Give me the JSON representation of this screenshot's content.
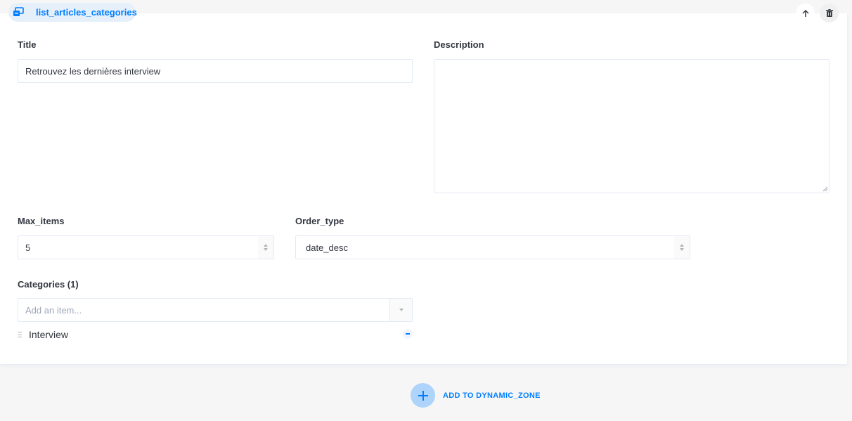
{
  "component": {
    "name": "list_articles_categories",
    "icon": "component-icon",
    "move_up_icon": "arrow-up-icon",
    "delete_icon": "trash-icon"
  },
  "fields": {
    "title": {
      "label": "Title",
      "value": "Retrouvez les dernières interview"
    },
    "description": {
      "label": "Description",
      "value": ""
    },
    "max_items": {
      "label": "Max_items",
      "value": "5"
    },
    "order_type": {
      "label": "Order_type",
      "value": "date_desc"
    },
    "categories": {
      "label": "Categories (1)",
      "placeholder": "Add an item...",
      "items": [
        {
          "label": "Interview"
        }
      ]
    }
  },
  "dynamic_zone": {
    "add_label": "ADD TO DYNAMIC_ZONE"
  },
  "colors": {
    "accent": "#007eff",
    "pill_bg": "#e6f0fb",
    "add_circle": "#aed4fb",
    "border": "#e3e9f3"
  }
}
